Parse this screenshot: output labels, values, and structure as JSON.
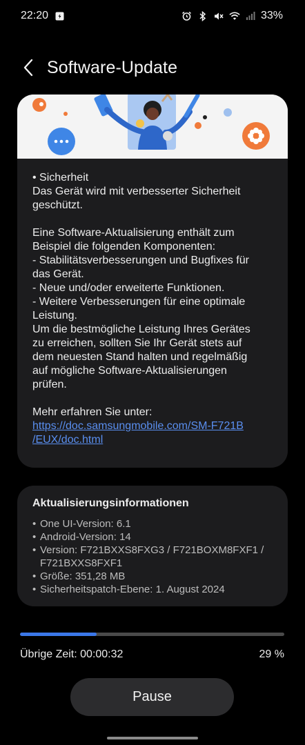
{
  "status_bar": {
    "time": "22:20",
    "battery": "33%",
    "icons": [
      "media-icon",
      "alarm-icon",
      "bluetooth-icon",
      "mute-icon",
      "wifi-icon",
      "signal-icon"
    ]
  },
  "header": {
    "title": "Software-Update",
    "back_icon": "back-arrow-icon"
  },
  "release_notes": {
    "body": "• Sicherheit\nDas Gerät wird mit verbesserter Sicherheit\ngeschützt.\n\nEine Software-Aktualisierung enthält zum\nBeispiel die folgenden Komponenten:\n - Stabilitätsverbesserungen und Bugfixes für\ndas Gerät.\n - Neue und/oder erweiterte Funktionen.\n - Weitere Verbesserungen für eine optimale\nLeistung.\nUm die bestmögliche Leistung Ihres Gerätes\nzu erreichen, sollten Sie Ihr Gerät stets auf\ndem neuesten Stand halten und regelmäßig\nauf mögliche Software-Aktualisierungen\nprüfen.",
    "more_label": "Mehr erfahren Sie unter:",
    "link_line1": "https://doc.samsungmobile.com/SM-F721B",
    "link_line2": "/EUX/doc.html"
  },
  "update_info": {
    "title": "Aktualisierungsinformationen",
    "items": [
      "One UI-Version: 6.1",
      "Android-Version: 14",
      "Version: F721BXXS8FXG3 / F721BOXM8FXF1 / F721BXXS8FXF1",
      "Größe: 351,28 MB",
      "Sicherheitspatch-Ebene: 1. August 2024"
    ]
  },
  "progress": {
    "remaining_label": "Übrige Zeit: 00:00:32",
    "percent_label": "29 %",
    "fraction": 0.29,
    "fill_color": "#3b77e8"
  },
  "pause_button": {
    "label": "Pause"
  }
}
